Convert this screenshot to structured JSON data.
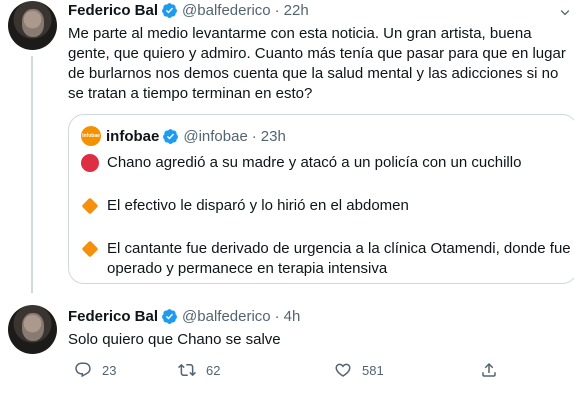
{
  "tweet1": {
    "name": "Federico Bal",
    "handle": "@balfederico",
    "dot": "·",
    "time": "22h",
    "text": "Me parte al medio levantarme con esta noticia. Un gran artista, buena gente, que quiero y admiro. Cuanto más tenía que pasar para que en lugar de burlarnos nos demos cuenta que la salud mental y las adicciones si no se tratan a tiempo terminan en esto?",
    "quote": {
      "avatar_text": "infobae",
      "name": "infobae",
      "handle": "@infobae",
      "dot": "·",
      "time": "23h",
      "lines": [
        {
          "icon": "red-circle",
          "text": "Chano agredió a su madre y atacó a un policía con un cuchillo"
        },
        {
          "icon": "orange-diamond",
          "text": "El efectivo le disparó y lo hirió en el abdomen"
        },
        {
          "icon": "orange-diamond",
          "text": "El cantante fue derivado de urgencia a la clínica Otamendi, donde fue operado y permanece en terapia intensiva"
        }
      ]
    }
  },
  "tweet2": {
    "name": "Federico Bal",
    "handle": "@balfederico",
    "dot": "·",
    "time": "4h",
    "text": "Solo quiero que Chano se salve",
    "actions": {
      "reply_count": "23",
      "retweet_count": "62",
      "like_count": "581"
    }
  },
  "colors": {
    "verified": "#1d9bf0",
    "secondary_text": "#536471",
    "border": "#cfd9de",
    "infobae_orange": "#f39200"
  }
}
